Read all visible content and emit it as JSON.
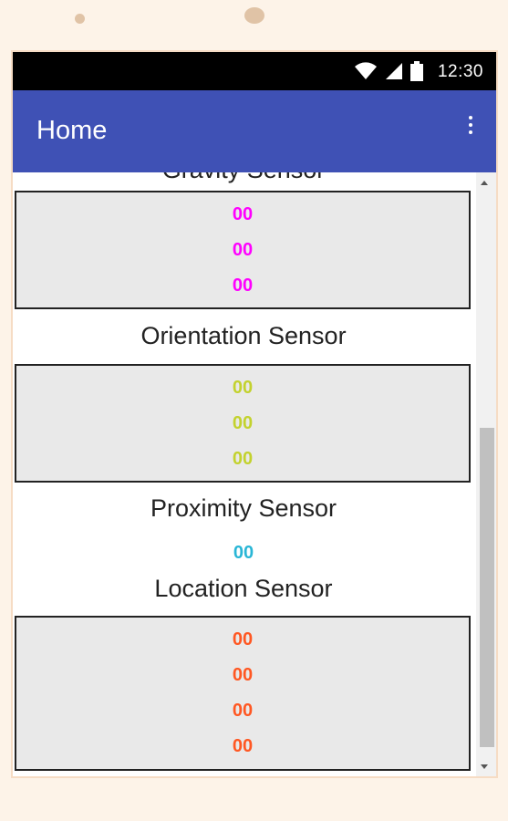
{
  "app": {
    "title": "Home",
    "status_time": "12:30"
  },
  "sections": {
    "top_partial_title": "Gravity Sensor",
    "top_values": [
      "00",
      "00",
      "00"
    ],
    "orientation_title": "Orientation Sensor",
    "orientation_values": [
      "00",
      "00",
      "00"
    ],
    "proximity_title": "Proximity Sensor",
    "proximity_value": "00",
    "location_title": "Location Sensor",
    "location_values": [
      "00",
      "00",
      "00",
      "00"
    ]
  },
  "colors": {
    "appbar": "#3f51b5",
    "top_values": "#ff00ff",
    "orientation_values": "#c3d22e",
    "proximity_value": "#29b6d6",
    "location_values": "#ff5722"
  },
  "icons": [
    "wifi-icon",
    "signal-icon",
    "battery-icon",
    "overflow-menu-icon"
  ]
}
